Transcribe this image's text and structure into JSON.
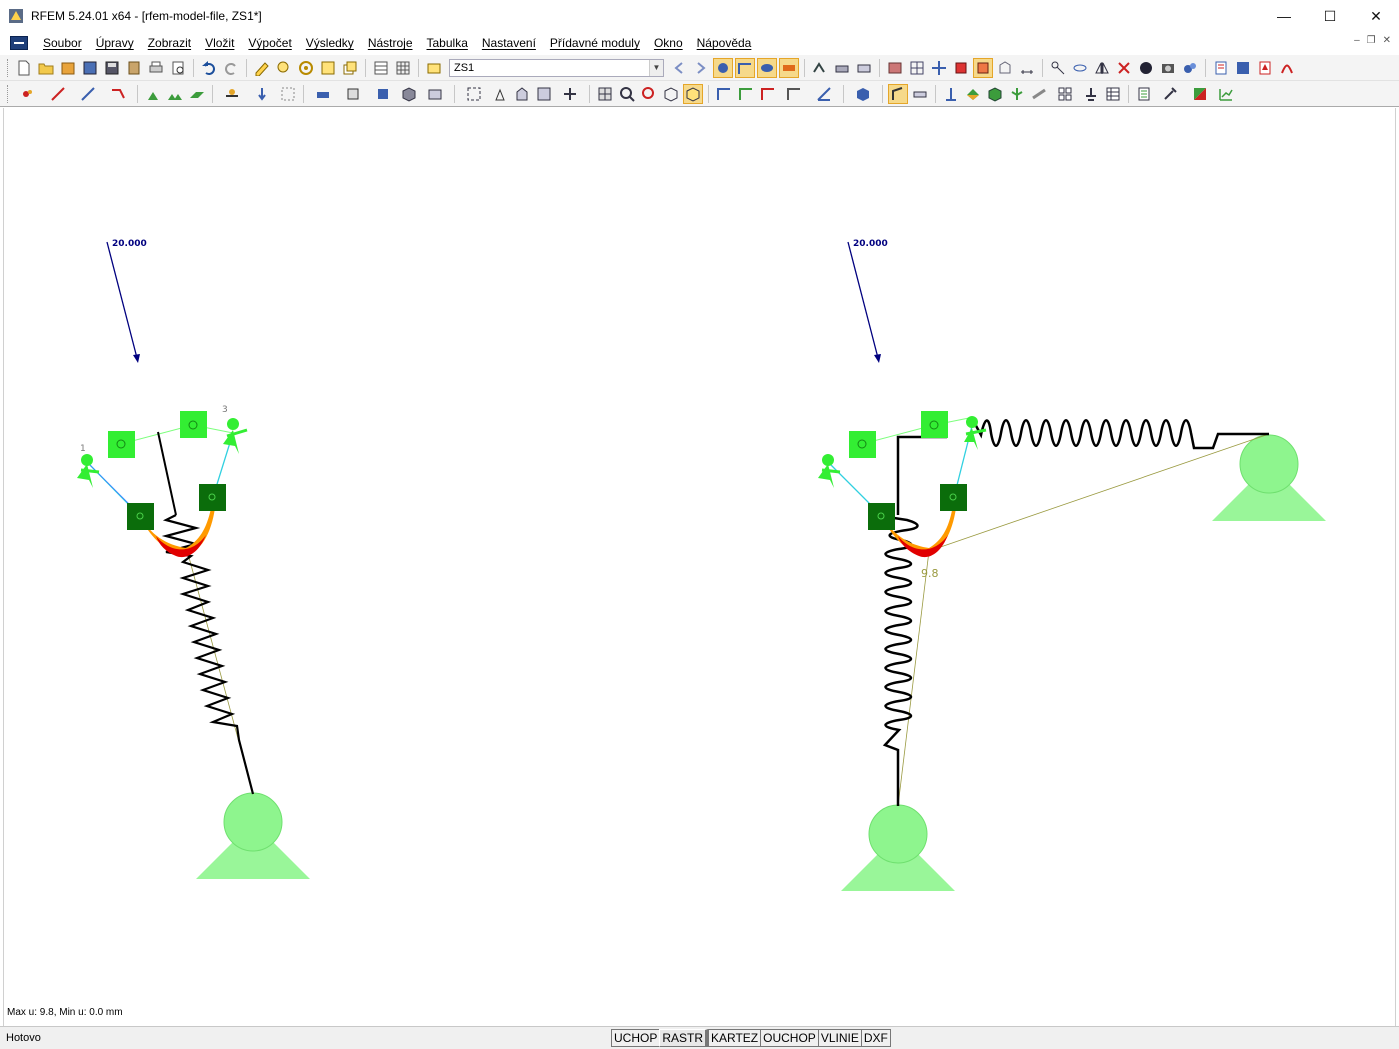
{
  "window": {
    "title": "RFEM 5.24.01 x64 - [rfem-model-file, ZS1*]",
    "controls": {
      "minimize": "—",
      "maximize": "☐",
      "close": "✕"
    }
  },
  "menu": {
    "items": [
      "Soubor",
      "Úpravy",
      "Zobrazit",
      "Vložit",
      "Výpočet",
      "Výsledky",
      "Nástroje",
      "Tabulka",
      "Nastavení",
      "Přídavné moduly",
      "Okno",
      "Nápověda"
    ],
    "mdi_controls": [
      "–",
      "❐",
      "✕"
    ]
  },
  "toolbar": {
    "load_case": "ZS1"
  },
  "canvas": {
    "left_model": {
      "load_value": "20.000",
      "node_labels": [
        "1",
        "3"
      ]
    },
    "right_model": {
      "load_value": "20.000",
      "max_label": "9.8"
    },
    "colors": {
      "support": "#8ef58e",
      "support_edge": "#5fd35f",
      "load": "#00007f",
      "spring": "#000000",
      "deform_red": "#e10000",
      "deform_orange": "#ff9a00",
      "hinge_light": "#33ee33",
      "hinge_dark": "#0b6d0b"
    }
  },
  "info": {
    "max_min": "Max u: 9.8, Min u: 0.0 mm"
  },
  "status": {
    "text": "Hotovo",
    "toggles": [
      {
        "label": "UCHOP",
        "pressed": false
      },
      {
        "label": "RASTR",
        "pressed": true
      },
      {
        "label": "KARTEZ",
        "pressed": false
      },
      {
        "label": "OUCHOP",
        "pressed": false
      },
      {
        "label": "VLINIE",
        "pressed": false
      },
      {
        "label": "DXF",
        "pressed": false
      }
    ]
  }
}
